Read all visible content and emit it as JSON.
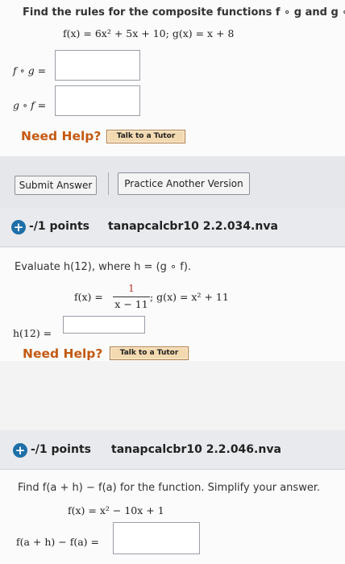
{
  "problem1": {
    "prompt": "Find the rules for the composite functions f ∘ g and g ∘ f.",
    "f_def": "f(x) = 6x² + 5x + 10;",
    "g_def": "g(x) = x + 8",
    "fog_label": "f ∘ g =",
    "gof_label": "g ∘ f =",
    "need_help": "Need Help?",
    "tutor_label": "Talk to a Tutor",
    "submit_label": "Submit Answer",
    "practice_label": "Practice Another Version"
  },
  "problem2": {
    "expand_icon": "+",
    "points": "-/1 points",
    "code": "tanapcalcbr10 2.2.034.nva",
    "prompt": "Evaluate h(12), where h = (g ∘ f).",
    "f_prefix": "f(x) =",
    "f_num": "1",
    "f_den": "x − 11",
    "g_def": "; g(x) = x² + 11",
    "answer_label": "h(12) =",
    "need_help": "Need Help?",
    "tutor_label": "Talk to a Tutor"
  },
  "problem3": {
    "expand_icon": "+",
    "points": "-/1 points",
    "code": "tanapcalcbr10 2.2.046.nva",
    "prompt": "Find f(a + h) − f(a) for the function. Simplify your answer.",
    "f_def": "f(x) = x² − 10x + 1",
    "answer_label": "f(a + h) − f(a) ="
  },
  "colors": {
    "accent_red": "#c0392b",
    "help_orange": "#c45a12",
    "plus_blue": "#1f6fa8"
  }
}
